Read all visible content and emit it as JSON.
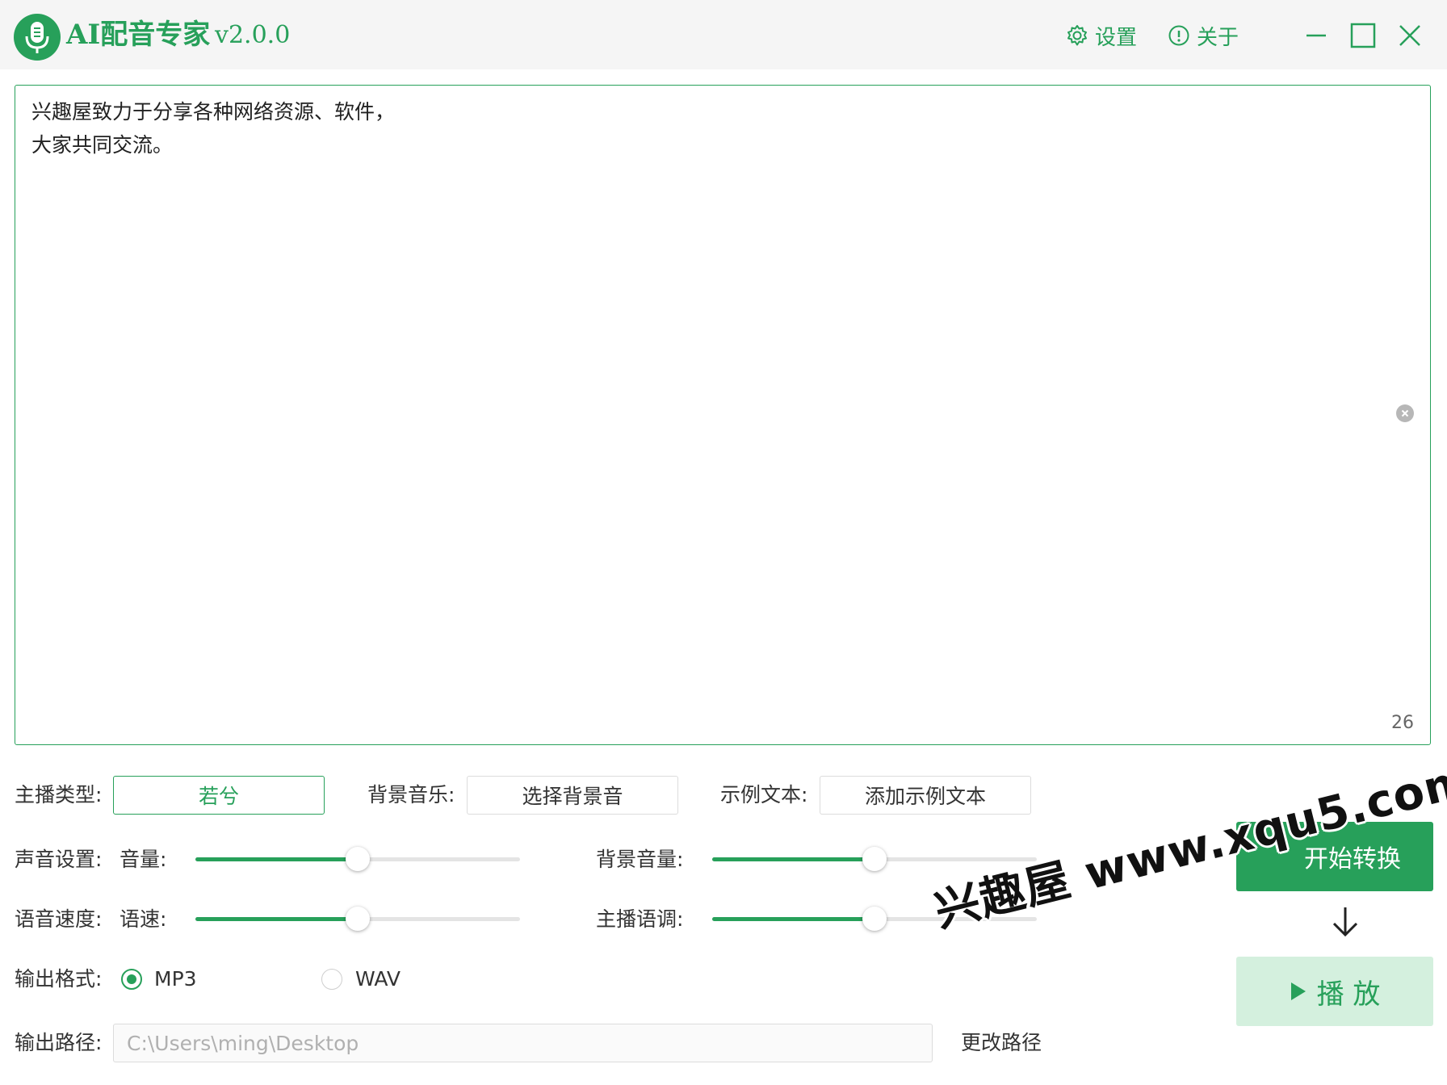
{
  "app": {
    "title": "AI配音专家",
    "version": "v2.0.0",
    "settings_label": "设置",
    "about_label": "关于"
  },
  "editor": {
    "text": "兴趣屋致力于分享各种网络资源、软件，\n大家共同交流。",
    "char_count": "26"
  },
  "options": {
    "anchor_type_label": "主播类型:",
    "anchor_value": "若兮",
    "bgm_label": "背景音乐:",
    "bgm_button": "选择背景音",
    "sample_text_label": "示例文本:",
    "sample_text_button": "添加示例文本"
  },
  "sound": {
    "section_label": "声音设置:",
    "volume_label": "音量:",
    "volume_level": 0.5,
    "bg_volume_label": "背景音量:",
    "bg_volume_level": 0.5
  },
  "speech": {
    "section_label": "语音速度:",
    "speed_label": "语速:",
    "speed_level": 0.5,
    "pitch_label": "主播语调:",
    "pitch_level": 0.5
  },
  "output": {
    "format_label": "输出格式:",
    "formats": [
      "MP3",
      "WAV"
    ],
    "selected_format": "MP3",
    "path_label": "输出路径:",
    "path_value": "C:\\Users\\ming\\Desktop",
    "change_path_label": "更改路径"
  },
  "actions": {
    "convert_label": "开始转换",
    "play_label": "播 放"
  },
  "watermark": "兴趣屋 www.xqu5.com",
  "colors": {
    "accent": "#27a05a",
    "accent_light": "#d4f0de"
  }
}
